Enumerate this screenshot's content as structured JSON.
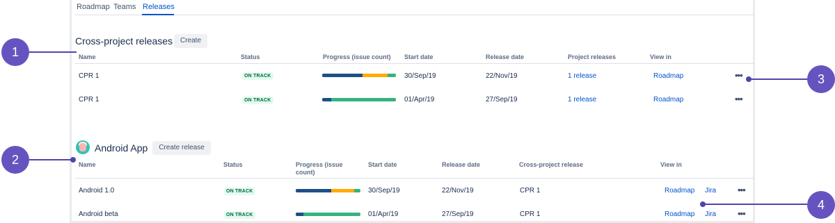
{
  "tabs": [
    "Roadmap",
    "Teams",
    "Releases"
  ],
  "cross_project": {
    "title": "Cross-project releases",
    "create_label": "Create",
    "headers": {
      "name": "Name",
      "status": "Status",
      "progress": "Progress (issue count)",
      "start": "Start date",
      "release": "Release date",
      "project_releases": "Project releases",
      "view_in": "View in"
    },
    "rows": [
      {
        "name": "CPR 1",
        "status": "ON TRACK",
        "progress": {
          "done": 0.55,
          "in_progress": 0.34,
          "todo": 0.11
        },
        "start": "30/Sep/19",
        "release": "22/Nov/19",
        "project_releases": "1 release",
        "view_in": "Roadmap",
        "more": "•••"
      },
      {
        "name": "CPR 1",
        "status": "ON TRACK",
        "progress": {
          "done": 0.12,
          "in_progress": 0.0,
          "todo": 0.88
        },
        "start": "01/Apr/19",
        "release": "27/Sep/19",
        "project_releases": "1 release",
        "view_in": "Roadmap",
        "more": "•••"
      }
    ]
  },
  "android": {
    "title": "Android App",
    "create_label": "Create release",
    "headers": {
      "name": "Name",
      "status": "Status",
      "progress_line1": "Progress (issue",
      "progress_line2": "count)",
      "start": "Start date",
      "release": "Release date",
      "cross_project_release": "Cross-project release",
      "view_in": "View in"
    },
    "rows": [
      {
        "name": "Android 1.0",
        "status": "ON TRACK",
        "progress": {
          "done": 0.55,
          "in_progress": 0.35,
          "todo": 0.1
        },
        "start": "30/Sep/19",
        "release": "22/Nov/19",
        "cpr": "CPR 1",
        "view_in": "Roadmap",
        "jira": "Jira",
        "more": "•••"
      },
      {
        "name": "Android beta",
        "status": "ON TRACK",
        "progress": {
          "done": 0.12,
          "in_progress": 0.0,
          "todo": 0.88
        },
        "start": "01/Apr/19",
        "release": "27/Sep/19",
        "cpr": "CPR 1",
        "view_in": "Roadmap",
        "jira": "Jira",
        "more": "•••"
      }
    ]
  },
  "callouts": [
    "1",
    "2",
    "3",
    "4"
  ],
  "colors": {
    "done": "#1e4f85",
    "in_progress": "#ffab00",
    "todo": "#36b37e",
    "accent": "#0052cc",
    "callout": "#6554c0"
  }
}
